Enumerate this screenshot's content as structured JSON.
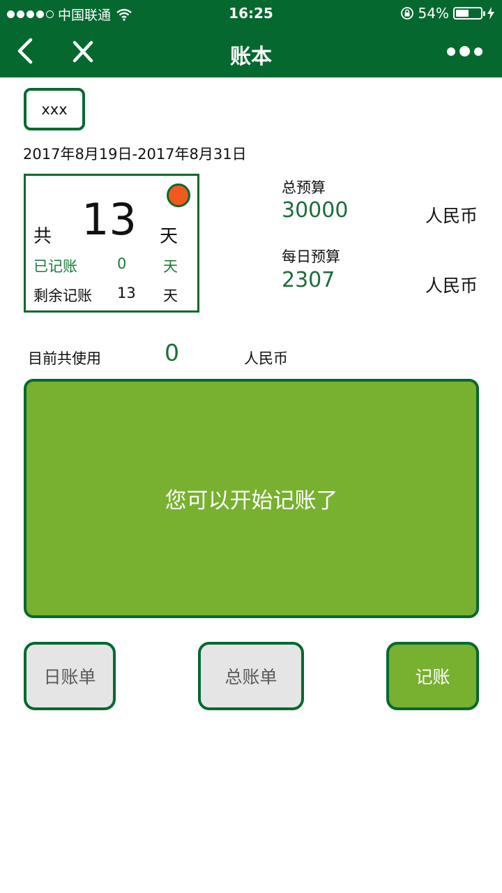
{
  "status_bar": {
    "carrier": "中国联通",
    "time": "16:25",
    "battery": "54%"
  },
  "navbar": {
    "title": "账本"
  },
  "account": {
    "tag": "xxx",
    "date_range": "2017年8月19日-2017年8月31日"
  },
  "days": {
    "prefix": "共",
    "total": "13",
    "unit": "天",
    "recorded_label": "已记账",
    "recorded_value": "0",
    "recorded_unit": "天",
    "remaining_label": "剩余记账",
    "remaining_value": "13",
    "remaining_unit": "天"
  },
  "budget": {
    "total_label": "总预算",
    "total_value": "30000",
    "total_unit": "人民币",
    "daily_label": "每日预算",
    "daily_value": "2307",
    "daily_unit": "人民币"
  },
  "usage": {
    "label": "目前共使用",
    "value": "0",
    "unit": "人民币"
  },
  "panel": {
    "message": "您可以开始记账了"
  },
  "actions": {
    "daily_bill": "日账单",
    "total_bill": "总账单",
    "record": "记账"
  },
  "colors": {
    "primary_dark_green": "#05692f",
    "accent_green": "#78b02f",
    "indicator_orange": "#f2591f"
  }
}
